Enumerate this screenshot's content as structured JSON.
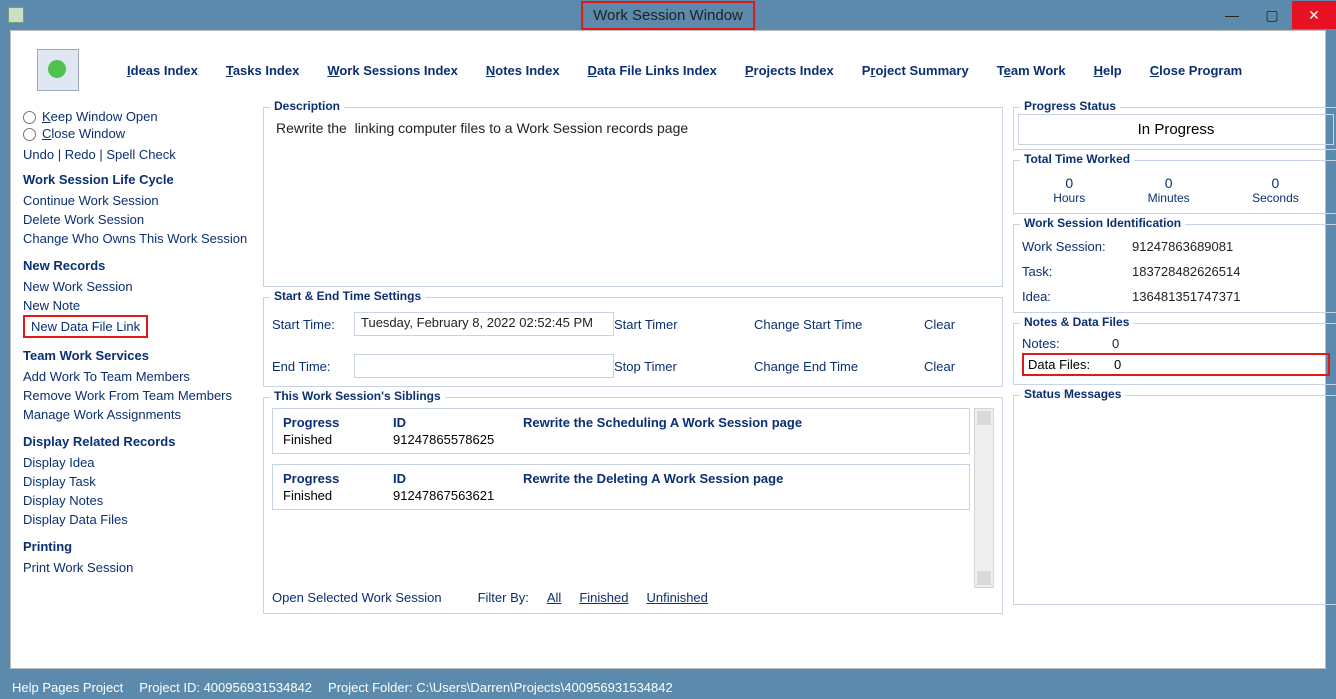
{
  "window_title": "Work Session Window",
  "menubar": {
    "items": [
      "Ideas Index",
      "Tasks Index",
      "Work Sessions Index",
      "Notes Index",
      "Data File Links Index",
      "Projects Index",
      "Project Summary",
      "Team Work",
      "Help",
      "Close Program"
    ]
  },
  "left": {
    "keep_open": "Keep Window Open",
    "close_window": "Close Window",
    "undo": "Undo",
    "redo": "Redo",
    "spell": "Spell Check",
    "sections": {
      "lifecycle": {
        "title": "Work Session Life Cycle",
        "items": [
          "Continue Work Session",
          "Delete Work Session",
          "Change Who Owns This Work Session"
        ]
      },
      "new_records": {
        "title": "New Records",
        "items": [
          "New Work Session",
          "New Note",
          "New Data File Link"
        ]
      },
      "team": {
        "title": "Team Work Services",
        "items": [
          "Add Work To Team Members",
          "Remove Work From Team Members",
          "Manage Work Assignments"
        ]
      },
      "display": {
        "title": "Display Related Records",
        "items": [
          "Display Idea",
          "Display Task",
          "Display Notes",
          "Display Data Files"
        ]
      },
      "printing": {
        "title": "Printing",
        "items": [
          "Print Work Session"
        ]
      }
    }
  },
  "center": {
    "description_label": "Description",
    "description_text": "Rewrite the  linking computer files to a Work Session records page",
    "time_settings_label": "Start & End Time Settings",
    "start_time_label": "Start Time:",
    "start_time_value": "Tuesday, February 8, 2022   02:52:45 PM",
    "end_time_label": "End Time:",
    "end_time_value": "",
    "start_timer": "Start Timer",
    "stop_timer": "Stop Timer",
    "change_start": "Change Start Time",
    "change_end": "Change End Time",
    "clear": "Clear",
    "siblings_label": "This Work Session's Siblings",
    "siblings": [
      {
        "progress": "Finished",
        "id": "91247865578625",
        "desc": "Rewrite the Scheduling A Work Session page"
      },
      {
        "progress": "Finished",
        "id": "91247867563621",
        "desc": "Rewrite the Deleting A Work Session page"
      }
    ],
    "sib_headers": {
      "progress": "Progress",
      "id": "ID"
    },
    "open_selected": "Open Selected Work Session",
    "filter_by": "Filter By:",
    "filter_all": "All",
    "filter_fin": "Finished",
    "filter_unfin": "Unfinished"
  },
  "right": {
    "progress_status_label": "Progress Status",
    "progress_status_value": "In Progress",
    "total_time_label": "Total Time Worked",
    "hours": "0",
    "minutes": "0",
    "seconds": "0",
    "hours_l": "Hours",
    "minutes_l": "Minutes",
    "seconds_l": "Seconds",
    "id_label": "Work Session Identification",
    "ws_label": "Work Session:",
    "ws_val": "91247863689081",
    "task_label": "Task:",
    "task_val": "183728482626514",
    "idea_label": "Idea:",
    "idea_val": "136481351747371",
    "notes_files_label": "Notes & Data Files",
    "notes_l": "Notes:",
    "notes_v": "0",
    "df_l": "Data Files:",
    "df_v": "0",
    "status_messages_label": "Status Messages"
  },
  "statusbar": {
    "help": "Help Pages Project",
    "project_id_l": "Project ID: ",
    "project_id": "400956931534842",
    "folder_l": "Project Folder: ",
    "folder": "C:\\Users\\Darren\\Projects\\400956931534842"
  }
}
